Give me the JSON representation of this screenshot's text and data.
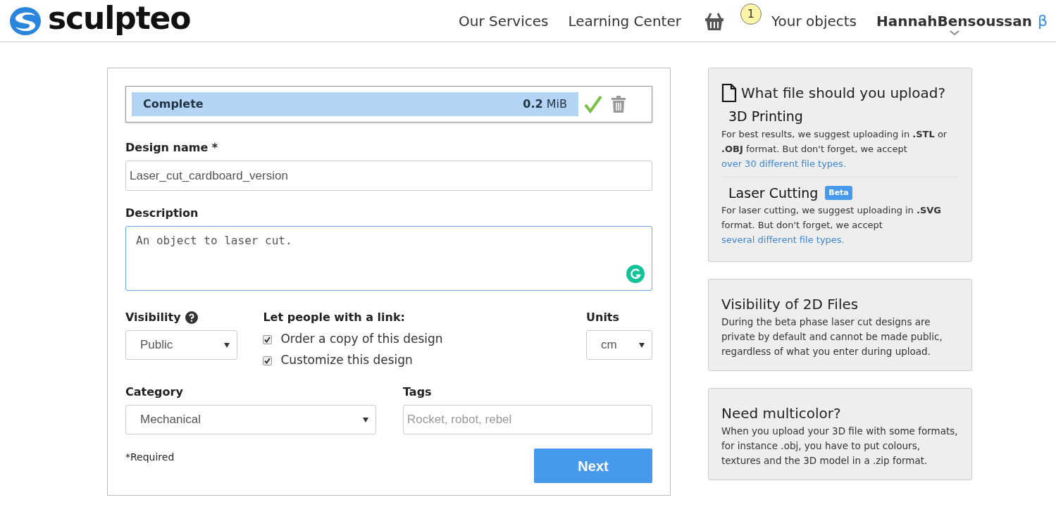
{
  "header": {
    "logo": "sculpteo",
    "nav": [
      "Our Services",
      "Learning Center"
    ],
    "cart_count": "1",
    "your_objects": "Your objects",
    "user": "HannahBensoussan",
    "beta_mark": "β"
  },
  "upload": {
    "status": "Complete",
    "size_value": "0.2",
    "size_unit": "MiB",
    "done": true
  },
  "form": {
    "design_name_label": "Design name *",
    "design_name_value": "Laser_cut_cardboard_version",
    "description_label": "Description",
    "description_value": "An object to laser cut.",
    "visibility_label": "Visibility",
    "visibility_value": "Public",
    "link_label": "Let people with a link:",
    "options": [
      {
        "label": "Order a copy of this design",
        "checked": true
      },
      {
        "label": "Customize this design",
        "checked": true
      }
    ],
    "units_label": "Units",
    "units_value": "cm",
    "category_label": "Category",
    "category_value": "Mechanical",
    "tags_label": "Tags",
    "tags_placeholder": "Rocket, robot, rebel",
    "required_note": "*Required",
    "next_button": "Next"
  },
  "sidebar": [
    {
      "kind": "upload_help",
      "title": "What file should you upload?",
      "sections": [
        {
          "title": "3D Printing",
          "text": "For best results, we suggest uploading in **.STL** or **.OBJ** format. But don't forget, we accept ",
          "link": "over 30 different file types."
        },
        {
          "title": "Laser Cutting",
          "badge": "Beta",
          "text": "For laser cutting, we suggest uploading in **.SVG** format. But don't forget, we accept ",
          "link": "several different file types."
        }
      ]
    },
    {
      "kind": "note",
      "title": "Visibility of 2D Files",
      "text": "During the beta phase laser cut designs are private by default and cannot be made public, regardless of what you enter during upload."
    },
    {
      "kind": "note",
      "title": "Need multicolor?",
      "text": "When you upload your 3D file with some formats, for instance .obj, you have to put colours, textures and the 3D model in a .zip format."
    }
  ]
}
